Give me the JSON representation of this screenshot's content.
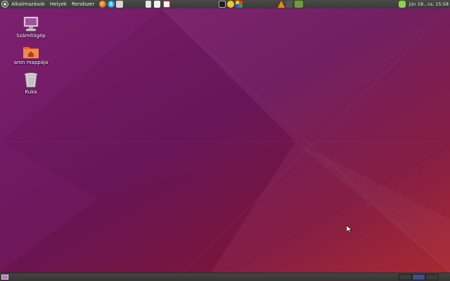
{
  "top_panel": {
    "menus": [
      "Alkalmazások",
      "Helyek",
      "Rendszer"
    ],
    "clock": "jún 18., cs, 15:58"
  },
  "desktop": {
    "icons": [
      {
        "label": "Számítógép",
        "icon": "computer-icon"
      },
      {
        "label": "aron mappája",
        "icon": "home-folder-icon"
      },
      {
        "label": "Kuka",
        "icon": "trash-icon"
      }
    ]
  },
  "colors": {
    "panel": "#3e3e3c",
    "wallpaper_top": "#7a1f6e",
    "wallpaper_bottom_right": "#a0212a",
    "folder_orange": "#e86a2c",
    "active_workspace": "#3d4f8f"
  },
  "bottom_panel": {
    "workspaces": [
      "workspace-1",
      "workspace-2",
      "workspace-3"
    ],
    "active_workspace_index": 2
  }
}
